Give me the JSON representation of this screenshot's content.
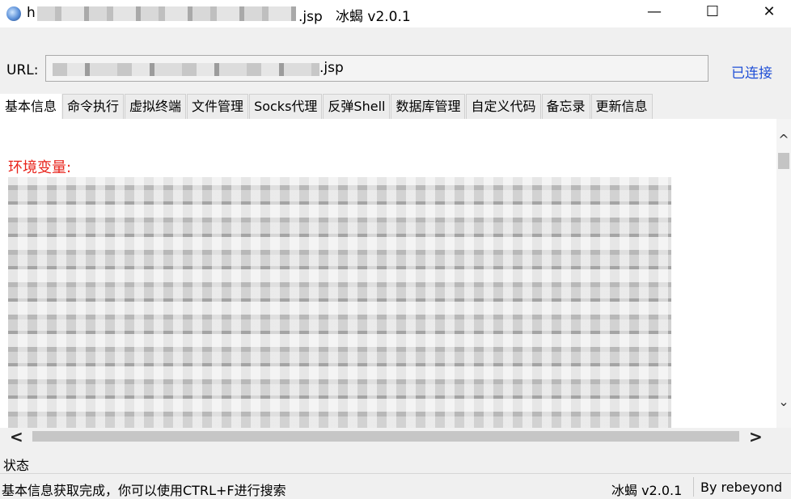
{
  "window": {
    "title_prefix": "h",
    "title_suffix": ".jsp   冰蝎 v2.0.1",
    "minimize": "—",
    "maximize": "☐",
    "close": "✕"
  },
  "url_bar": {
    "label": "URL:",
    "value_suffix": ".jsp",
    "status": "已连接",
    "status_color": "#1f4fd6"
  },
  "tabs": [
    {
      "label": "基本信息",
      "active": true
    },
    {
      "label": "命令执行"
    },
    {
      "label": "虚拟终端"
    },
    {
      "label": "文件管理"
    },
    {
      "label": "Socks代理"
    },
    {
      "label": "反弹Shell"
    },
    {
      "label": "数据库管理"
    },
    {
      "label": "自定义代码"
    },
    {
      "label": "备忘录"
    },
    {
      "label": "更新信息"
    }
  ],
  "content": {
    "heading": "环境变量:",
    "heading_color": "#e8241c"
  },
  "scrollbars": {
    "up": "^",
    "down": "⌄",
    "left": "<",
    "right": ">"
  },
  "status": {
    "title": "状态",
    "message": "基本信息获取完成，你可以使用CTRL+F进行搜索",
    "version": "冰蝎 v2.0.1",
    "author": "By rebeyond"
  }
}
